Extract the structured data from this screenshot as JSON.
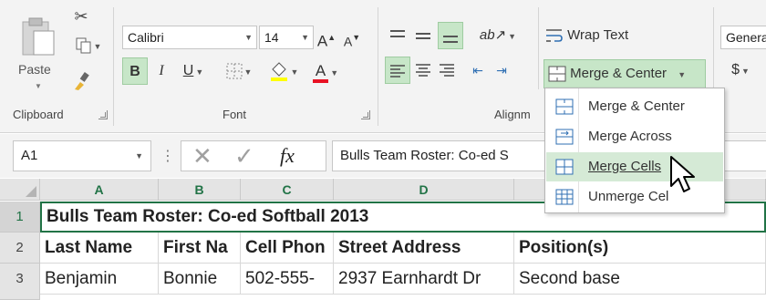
{
  "clipboard": {
    "paste_label": "Paste",
    "group_label": "Clipboard"
  },
  "font": {
    "name": "Calibri",
    "size": "14",
    "group_label": "Font",
    "bold": "B",
    "italic": "I",
    "underline": "U",
    "font_color_letter": "A",
    "grow_letter": "A",
    "shrink_letter": "A"
  },
  "alignment": {
    "group_label": "Alignm",
    "wrap_text_label": "Wrap Text",
    "merge_center_label": "Merge & Center"
  },
  "number": {
    "format_label": "Genera",
    "currency_symbol": "$"
  },
  "merge_menu": {
    "items": [
      {
        "label": "Merge & Center"
      },
      {
        "label": "Merge Across"
      },
      {
        "label": "Merge Cells"
      },
      {
        "label": "Unmerge Cel"
      }
    ]
  },
  "formula_bar": {
    "name_box": "A1",
    "fx": "fx",
    "content": "Bulls Team Roster: Co-ed S"
  },
  "grid": {
    "columns": [
      "A",
      "B",
      "C",
      "D",
      ""
    ],
    "rows": [
      {
        "num": "1",
        "cells": [
          "Bulls Team Roster: Co-ed Softball 2013"
        ]
      },
      {
        "num": "2",
        "cells": [
          "Last Name",
          "First Na",
          "Cell Phon",
          "Street Address",
          "Position(s)"
        ]
      },
      {
        "num": "3",
        "cells": [
          "Benjamin",
          "Bonnie",
          "502-555-",
          "2937 Earnhardt Dr",
          "Second base"
        ]
      }
    ]
  },
  "colors": {
    "accent_green": "#217346",
    "highlight_green": "#c7e6c8"
  }
}
